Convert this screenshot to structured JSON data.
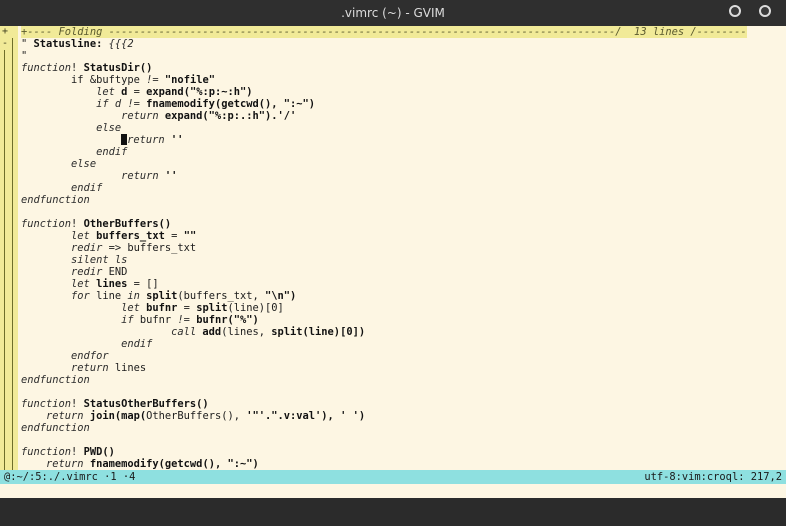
{
  "window": {
    "title": ".vimrc (~) - GVIM"
  },
  "fold_header": {
    "marker": "+",
    "text": "+---- Folding ---------------------------------------------------------------------------------/  13 lines /--------"
  },
  "lines": [
    {
      "type": "fold",
      "marker": "-",
      "parts": [
        {
          "t": "\" ",
          "c": "n"
        },
        {
          "t": "Statusline:",
          "c": "b"
        },
        {
          "t": " {{{2",
          "c": "kw"
        }
      ]
    },
    {
      "parts": [
        {
          "t": "\"",
          "c": "n"
        }
      ]
    },
    {
      "parts": [
        {
          "t": "function",
          "c": "kw"
        },
        {
          "t": "! ",
          "c": "n"
        },
        {
          "t": "StatusDir()",
          "c": "b"
        }
      ]
    },
    {
      "parts": [
        {
          "t": "        if ",
          "c": "n"
        },
        {
          "t": "&buftype ",
          "c": "n"
        },
        {
          "t": "!= ",
          "c": "kw"
        },
        {
          "t": "\"nofile\"",
          "c": "b"
        }
      ]
    },
    {
      "parts": [
        {
          "t": "            ",
          "c": "n"
        },
        {
          "t": "let ",
          "c": "kw"
        },
        {
          "t": "d",
          "c": "b"
        },
        {
          "t": " = ",
          "c": "n"
        },
        {
          "t": "expand(\"%:p:~:h\")",
          "c": "b"
        }
      ]
    },
    {
      "parts": [
        {
          "t": "            ",
          "c": "n"
        },
        {
          "t": "if d != ",
          "c": "kw"
        },
        {
          "t": "fnamemodify(",
          "c": "b"
        },
        {
          "t": "getcwd",
          "c": "b"
        },
        {
          "t": "(), \":~\")",
          "c": "b"
        }
      ]
    },
    {
      "parts": [
        {
          "t": "                ",
          "c": "n"
        },
        {
          "t": "return ",
          "c": "kw"
        },
        {
          "t": "expand(\"%:p:.:h\").'/'",
          "c": "b"
        }
      ]
    },
    {
      "parts": [
        {
          "t": "            ",
          "c": "n"
        },
        {
          "t": "else",
          "c": "kw"
        }
      ]
    },
    {
      "parts": [
        {
          "t": "                ",
          "c": "n"
        },
        {
          "t": "CURSOR",
          "c": "cur"
        },
        {
          "t": "return ",
          "c": "kw"
        },
        {
          "t": "''",
          "c": "b"
        }
      ]
    },
    {
      "parts": [
        {
          "t": "            ",
          "c": "n"
        },
        {
          "t": "endif",
          "c": "kw"
        }
      ]
    },
    {
      "parts": [
        {
          "t": "        ",
          "c": "n"
        },
        {
          "t": "else",
          "c": "kw"
        }
      ]
    },
    {
      "parts": [
        {
          "t": "                ",
          "c": "n"
        },
        {
          "t": "return ",
          "c": "kw"
        },
        {
          "t": "''",
          "c": "b"
        }
      ]
    },
    {
      "parts": [
        {
          "t": "        ",
          "c": "n"
        },
        {
          "t": "endif",
          "c": "kw"
        }
      ]
    },
    {
      "parts": [
        {
          "t": "endfunction",
          "c": "kw"
        }
      ]
    },
    {
      "parts": []
    },
    {
      "parts": [
        {
          "t": "function",
          "c": "kw"
        },
        {
          "t": "! ",
          "c": "n"
        },
        {
          "t": "OtherBuffers()",
          "c": "b"
        }
      ]
    },
    {
      "parts": [
        {
          "t": "        ",
          "c": "n"
        },
        {
          "t": "let ",
          "c": "kw"
        },
        {
          "t": "buffers_txt",
          "c": "b"
        },
        {
          "t": " = ",
          "c": "n"
        },
        {
          "t": "\"\"",
          "c": "b"
        }
      ]
    },
    {
      "parts": [
        {
          "t": "        ",
          "c": "n"
        },
        {
          "t": "redir ",
          "c": "kw"
        },
        {
          "t": "=> buffers_txt",
          "c": "n"
        }
      ]
    },
    {
      "parts": [
        {
          "t": "        ",
          "c": "n"
        },
        {
          "t": "silent ls",
          "c": "kw"
        }
      ]
    },
    {
      "parts": [
        {
          "t": "        ",
          "c": "n"
        },
        {
          "t": "redir ",
          "c": "kw"
        },
        {
          "t": "END",
          "c": "n"
        }
      ]
    },
    {
      "parts": [
        {
          "t": "        ",
          "c": "n"
        },
        {
          "t": "let ",
          "c": "kw"
        },
        {
          "t": "lines",
          "c": "b"
        },
        {
          "t": " = []",
          "c": "n"
        }
      ]
    },
    {
      "parts": [
        {
          "t": "        ",
          "c": "n"
        },
        {
          "t": "for ",
          "c": "kw"
        },
        {
          "t": "line ",
          "c": "n"
        },
        {
          "t": "in ",
          "c": "kw"
        },
        {
          "t": "split",
          "c": "b"
        },
        {
          "t": "(buffers_txt, ",
          "c": "n"
        },
        {
          "t": "\"\\n\")",
          "c": "b"
        }
      ]
    },
    {
      "parts": [
        {
          "t": "                ",
          "c": "n"
        },
        {
          "t": "let ",
          "c": "kw"
        },
        {
          "t": "bufnr",
          "c": "b"
        },
        {
          "t": " = ",
          "c": "n"
        },
        {
          "t": "split",
          "c": "b"
        },
        {
          "t": "(line)[0]",
          "c": "n"
        }
      ]
    },
    {
      "parts": [
        {
          "t": "                ",
          "c": "n"
        },
        {
          "t": "if ",
          "c": "kw"
        },
        {
          "t": "bufnr ",
          "c": "n"
        },
        {
          "t": "!= ",
          "c": "kw"
        },
        {
          "t": "bufnr(\"%\")",
          "c": "b"
        }
      ]
    },
    {
      "parts": [
        {
          "t": "                        ",
          "c": "n"
        },
        {
          "t": "call ",
          "c": "kw"
        },
        {
          "t": "add",
          "c": "b"
        },
        {
          "t": "(lines, ",
          "c": "n"
        },
        {
          "t": "split",
          "c": "b"
        },
        {
          "t": "(line)[0])",
          "c": "b"
        }
      ]
    },
    {
      "parts": [
        {
          "t": "                ",
          "c": "n"
        },
        {
          "t": "endif",
          "c": "kw"
        }
      ]
    },
    {
      "parts": [
        {
          "t": "        ",
          "c": "n"
        },
        {
          "t": "endfor",
          "c": "kw"
        }
      ]
    },
    {
      "parts": [
        {
          "t": "        ",
          "c": "n"
        },
        {
          "t": "return ",
          "c": "kw"
        },
        {
          "t": "lines",
          "c": "n"
        }
      ]
    },
    {
      "parts": [
        {
          "t": "endfunction",
          "c": "kw"
        }
      ]
    },
    {
      "parts": []
    },
    {
      "parts": [
        {
          "t": "function",
          "c": "kw"
        },
        {
          "t": "! ",
          "c": "n"
        },
        {
          "t": "StatusOtherBuffers()",
          "c": "b"
        }
      ]
    },
    {
      "parts": [
        {
          "t": "    ",
          "c": "n"
        },
        {
          "t": "return ",
          "c": "kw"
        },
        {
          "t": "join(map(",
          "c": "b"
        },
        {
          "t": "OtherBuffers(), ",
          "c": "n"
        },
        {
          "t": "'\"'.\".v:val'), ' ')",
          "c": "b"
        }
      ]
    },
    {
      "parts": [
        {
          "t": "endfunction",
          "c": "kw"
        }
      ]
    },
    {
      "parts": []
    },
    {
      "parts": [
        {
          "t": "function",
          "c": "kw"
        },
        {
          "t": "! ",
          "c": "n"
        },
        {
          "t": "PWD()",
          "c": "b"
        }
      ]
    },
    {
      "parts": [
        {
          "t": "    ",
          "c": "n"
        },
        {
          "t": "return ",
          "c": "kw"
        },
        {
          "t": "fnamemodify(",
          "c": "b"
        },
        {
          "t": "getcwd",
          "c": "b"
        },
        {
          "t": "(), \":~\")",
          "c": "b"
        }
      ]
    }
  ],
  "statusline": {
    "left": "@:~/:5:./.vimrc ·1 ·4",
    "right": "utf-8:vim:croql: 217,2"
  },
  "colors": {
    "background": "#fdf6e3",
    "foldcolumn": "#f1ea98",
    "statusline": "#8ee0e0",
    "titlebar": "#2f2f2f"
  }
}
